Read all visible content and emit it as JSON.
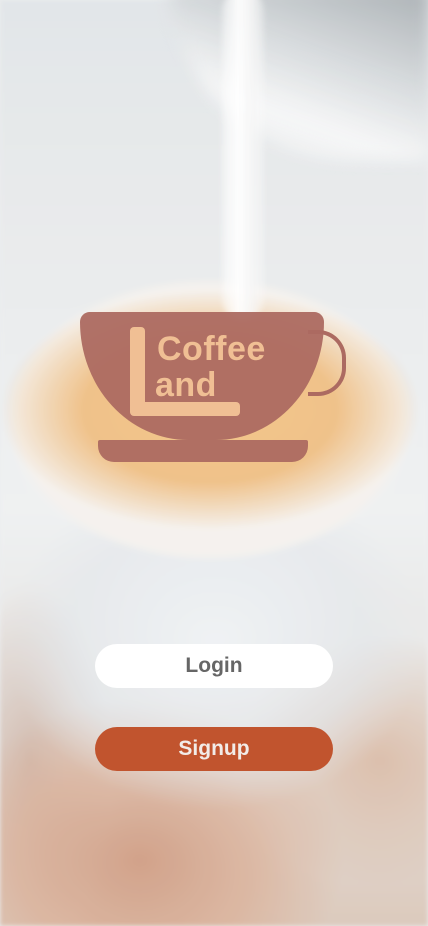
{
  "logo": {
    "word1": "Coffee",
    "word2": "and",
    "letter": "L",
    "cup_color": "#ac6a61",
    "text_color": "#f0bf94"
  },
  "actions": {
    "login_label": "Login",
    "signup_label": "Signup"
  },
  "colors": {
    "signup_bg": "#c1542e",
    "login_bg": "#ffffff",
    "login_text": "#666666"
  }
}
